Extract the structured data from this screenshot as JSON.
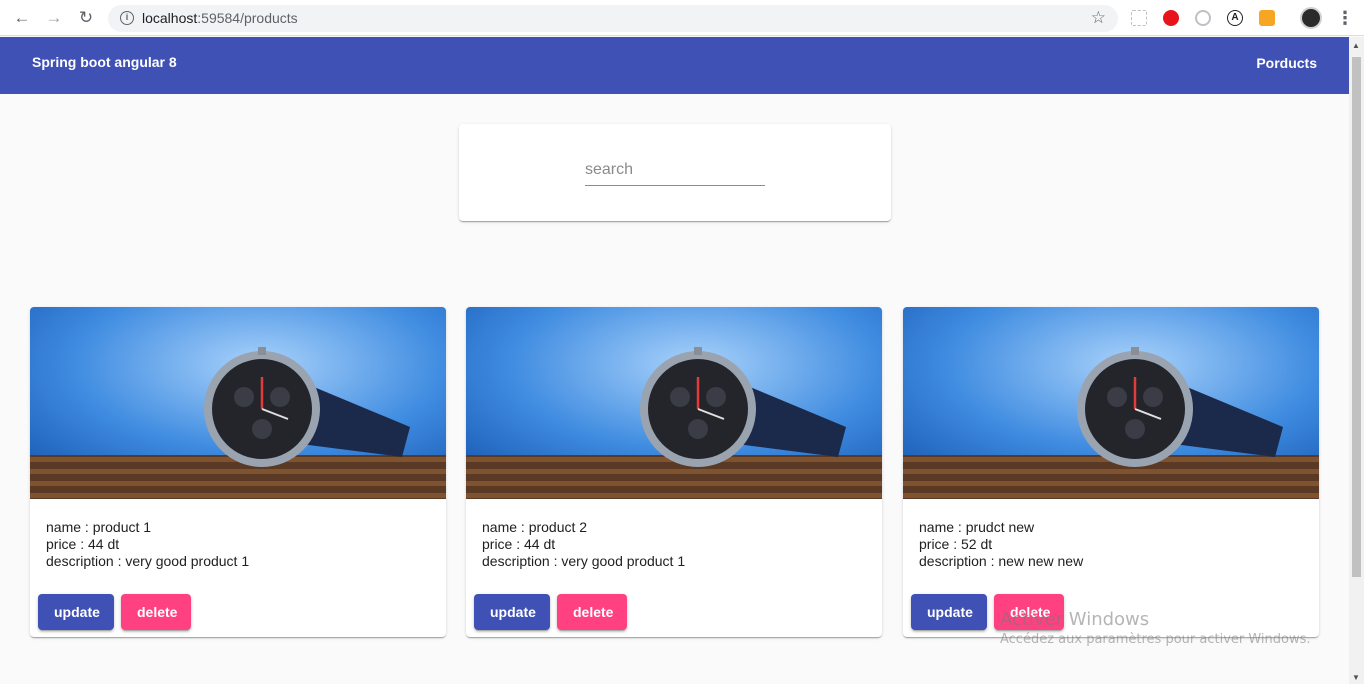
{
  "browser": {
    "url_host": "localhost",
    "url_path": ":59584/products",
    "back_icon": "arrow-left-icon",
    "forward_icon": "arrow-right-icon",
    "reload_icon": "reload-icon",
    "info_icon": "info-icon",
    "star_icon": "star-icon"
  },
  "toolbar": {
    "title": "Spring boot angular 8",
    "nav_link": "Porducts",
    "color": "#3f51b5"
  },
  "search": {
    "placeholder": "search",
    "value": ""
  },
  "products": [
    {
      "name_line": "name : product 1",
      "price_line": "price : 44 dt",
      "description_line": "description : very good product 1",
      "update_label": "update",
      "delete_label": "delete"
    },
    {
      "name_line": "name : product 2",
      "price_line": "price : 44 dt",
      "description_line": "description : very good product 1",
      "update_label": "update",
      "delete_label": "delete"
    },
    {
      "name_line": "name : prudct new",
      "price_line": "price : 52 dt",
      "description_line": "description : new new new",
      "update_label": "update",
      "delete_label": "delete"
    }
  ],
  "colors": {
    "primary": "#3f51b5",
    "accent": "#ff4081",
    "background": "#fafafa"
  },
  "watermark": {
    "title": "Activer Windows",
    "subtitle": "Accédez aux paramètres pour activer Windows."
  }
}
